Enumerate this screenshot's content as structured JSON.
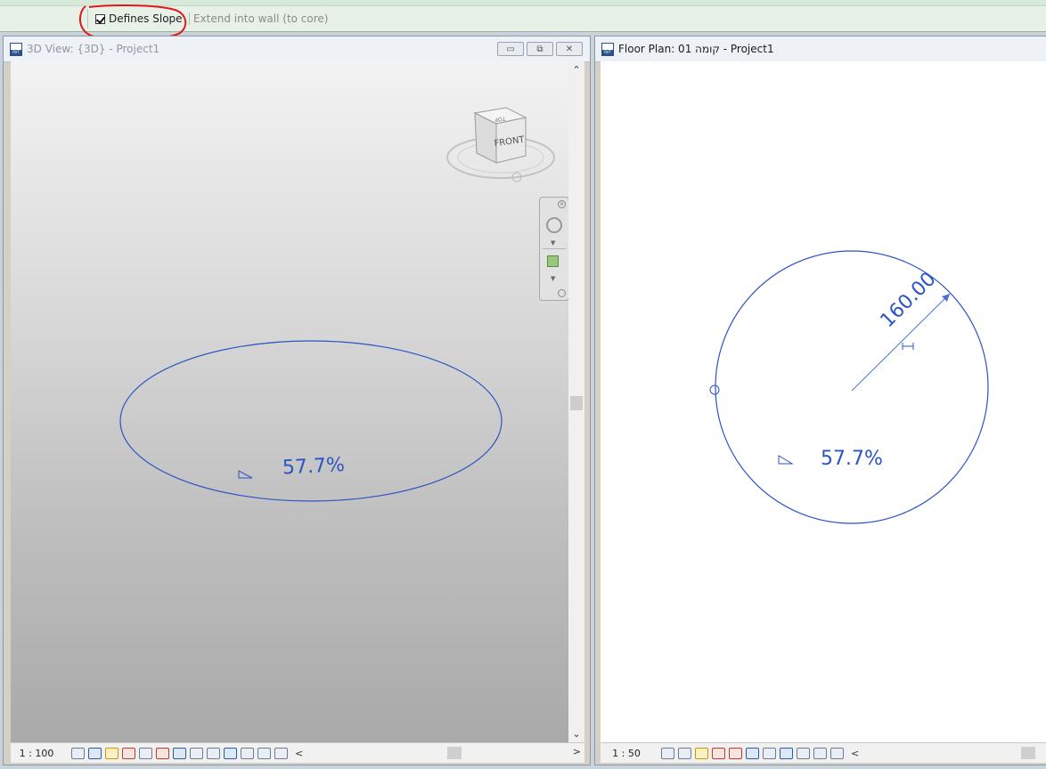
{
  "options_bar": {
    "defines_slope": {
      "label": "Defines Slope",
      "checked": true
    },
    "extend_into_wall": {
      "label": "Extend into wall (to core)",
      "checked": false,
      "enabled": false
    }
  },
  "left_view": {
    "title": "3D View: {3D} - Project1",
    "scale": "1 : 100",
    "slope_label": "57.7%",
    "viewcube": {
      "face": "FRONT",
      "top": "TOP"
    }
  },
  "right_view": {
    "title": "Floor Plan: 01 קומה - Project1",
    "scale": "1 : 50",
    "slope_label": "57.7%",
    "radius_dimension": "160.00"
  },
  "colors": {
    "sketch_line": "#2b55c4",
    "highlight_ring": "#e01818"
  }
}
